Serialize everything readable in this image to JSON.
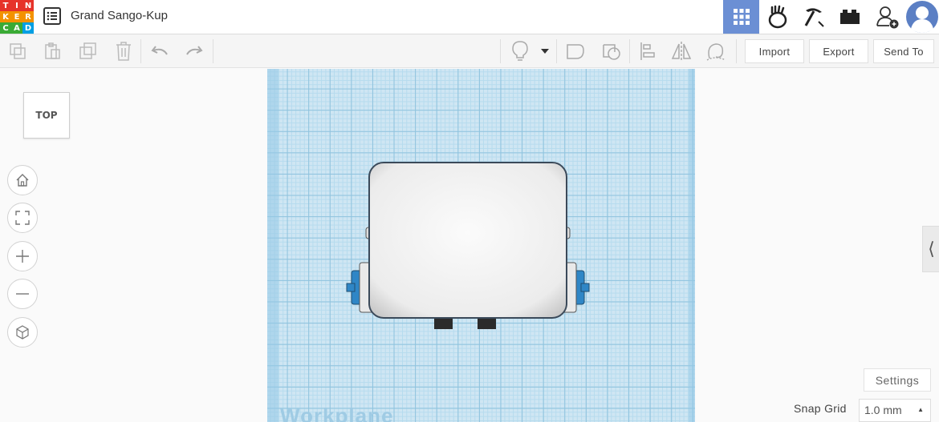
{
  "app": {
    "logo_letters": [
      "T",
      "I",
      "N",
      "K",
      "E",
      "R",
      "C",
      "A",
      "D"
    ],
    "logo_colors": [
      "#e6332a",
      "#e6332a",
      "#e6332a",
      "#f39200",
      "#f39200",
      "#f39200",
      "#3aaa35",
      "#3aaa35",
      "#009fe3"
    ],
    "project_title": "Grand Sango-Kup"
  },
  "header_nav": {
    "icons": [
      "grid-view-icon",
      "gallery-icon",
      "pickaxe-icon",
      "bricks-icon",
      "add-user-icon",
      "user-avatar"
    ]
  },
  "toolbar": {
    "import_label": "Import",
    "export_label": "Export",
    "send_to_label": "Send To"
  },
  "viewcube": {
    "face_label": "TOP"
  },
  "workplane": {
    "label": "Workplane"
  },
  "settings": {
    "label": "Settings",
    "snap_grid_label": "Snap Grid",
    "snap_grid_value": "1.0 mm"
  },
  "colors": {
    "active_nav": "#6b8fd4",
    "workplane": "#cfe6f3",
    "part_blue": "#2f86c6"
  }
}
